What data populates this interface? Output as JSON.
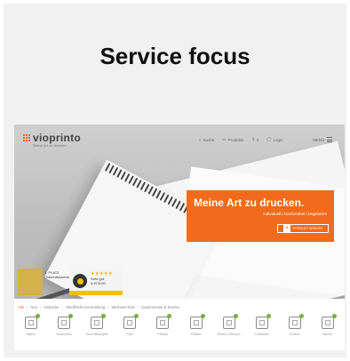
{
  "heading": "Service focus",
  "site": {
    "logo_text": "vioprinto",
    "logo_sub": "Meine Art zu drucken",
    "nav": [
      "Suche",
      "Produkte",
      "0",
      "Login"
    ],
    "menu_label": "MENÜ"
  },
  "banner": {
    "title": "Meine Art zu drucken.",
    "subtitle": "individuell | komfortabel | begeistern",
    "button": "PRODUKT WÄHLEN"
  },
  "trust": {
    "seal_lines": [
      "1. PLATZ",
      "Onlinedruckerei"
    ],
    "badge_stars": "★★★★★",
    "badge_lines": [
      "Sehr gut",
      "4.97/5.00"
    ]
  },
  "tabs": [
    "Alle",
    "Neu",
    "Kalender",
    "Oberflächenveredelung",
    "Werbetechnik",
    "Gastronomie & Events"
  ],
  "categories": [
    "Bücher",
    "Broschüren",
    "Geschäftspapier",
    "Flyer",
    "Faltflyer",
    "Plakate",
    "Briefe & Stempel",
    "Postkarten",
    "Schilder",
    "Banner"
  ]
}
